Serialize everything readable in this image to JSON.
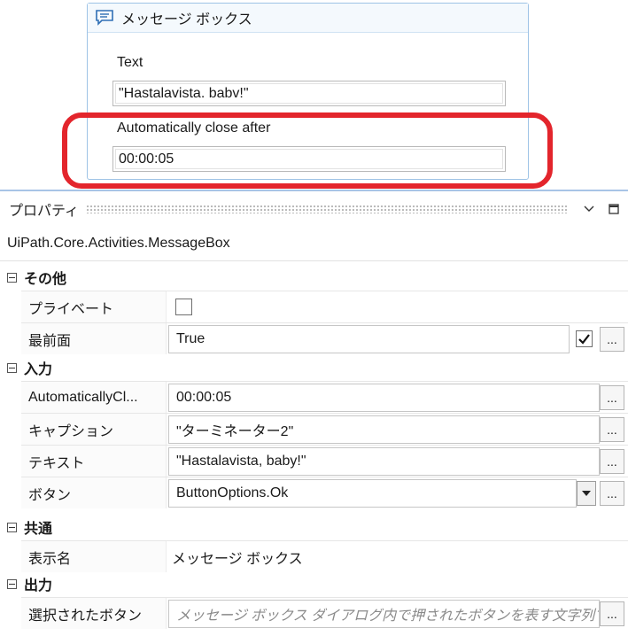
{
  "activity": {
    "title": "メッセージ ボックス",
    "text_label": "Text",
    "text_value": "\"Hastalavista. babv!\"",
    "auto_close_label": "Automatically close after",
    "auto_close_value": "00:00:05"
  },
  "properties": {
    "panel_title": "プロパティ",
    "type_name": "UiPath.Core.Activities.MessageBox",
    "categories": {
      "misc": "その他",
      "input": "入力",
      "common": "共通",
      "output": "出力"
    },
    "rows": {
      "private_label": "プライベート",
      "topmost_label": "最前面",
      "topmost_value": "True",
      "auto_close_label": "AutomaticallyCl...",
      "auto_close_value": "00:00:05",
      "caption_label": "キャプション",
      "caption_value": "\"ターミネーター2\"",
      "text_label": "テキスト",
      "text_value": "\"Hastalavista, baby!\"",
      "buttons_label": "ボタン",
      "buttons_value": "ButtonOptions.Ok",
      "display_name_label": "表示名",
      "display_name_value": "メッセージ ボックス",
      "selected_button_label": "選択されたボタン",
      "selected_button_placeholder": "メッセージ ボックス ダイアログ内で押されたボタンを表す文字列です。",
      "ellipsis": "..."
    },
    "checkbox_states": {
      "private": false,
      "topmost": true
    }
  },
  "icons": [
    "message-box-icon",
    "chevron-down-icon",
    "maximize-icon",
    "collapse-icon",
    "dropdown-arrow-icon",
    "checkmark-icon"
  ],
  "colors": {
    "highlight": "#e3252c",
    "accent_border": "#9ec3e6"
  }
}
